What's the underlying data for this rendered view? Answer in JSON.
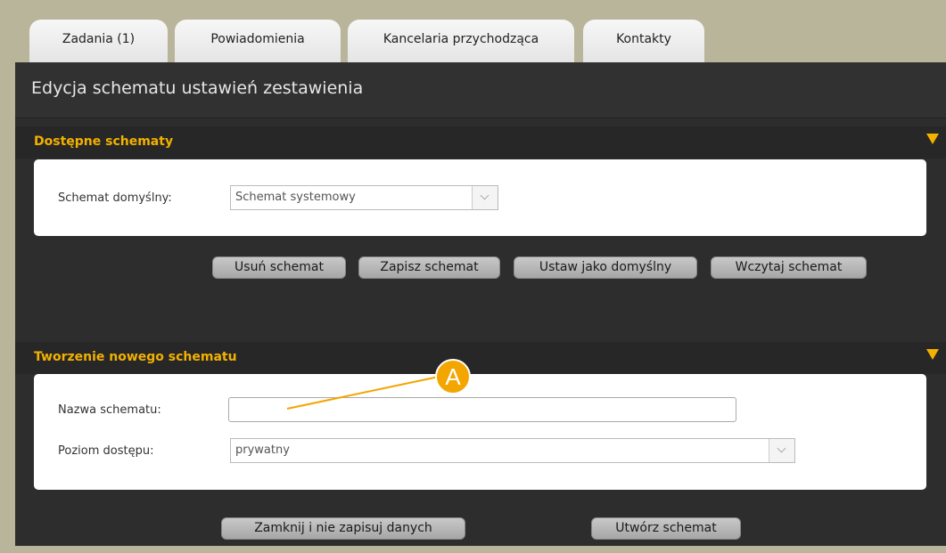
{
  "tabs": [
    {
      "label": "Zadania (1)"
    },
    {
      "label": "Powiadomienia"
    },
    {
      "label": "Kancelaria przychodząca"
    },
    {
      "label": "Kontakty"
    }
  ],
  "dialog": {
    "title": "Edycja schematu ustawień zestawienia",
    "available": {
      "header": "Dostępne schematy",
      "default_label": "Schemat domyślny:",
      "default_value": "Schemat systemowy",
      "buttons": {
        "delete": "Usuń schemat",
        "save": "Zapisz schemat",
        "set_default": "Ustaw jako domyślny",
        "load": "Wczytaj schemat"
      }
    },
    "create": {
      "header": "Tworzenie nowego schematu",
      "name_label": "Nazwa schematu:",
      "name_value": "",
      "access_label": "Poziom dostępu:",
      "access_value": "prywatny"
    },
    "footer": {
      "close": "Zamknij i nie zapisuj danych",
      "create": "Utwórz schemat"
    }
  },
  "annotation": {
    "label": "A"
  },
  "colors": {
    "accent": "#f3b100",
    "window": "#2d2d2d",
    "background": "#b9b59b"
  }
}
